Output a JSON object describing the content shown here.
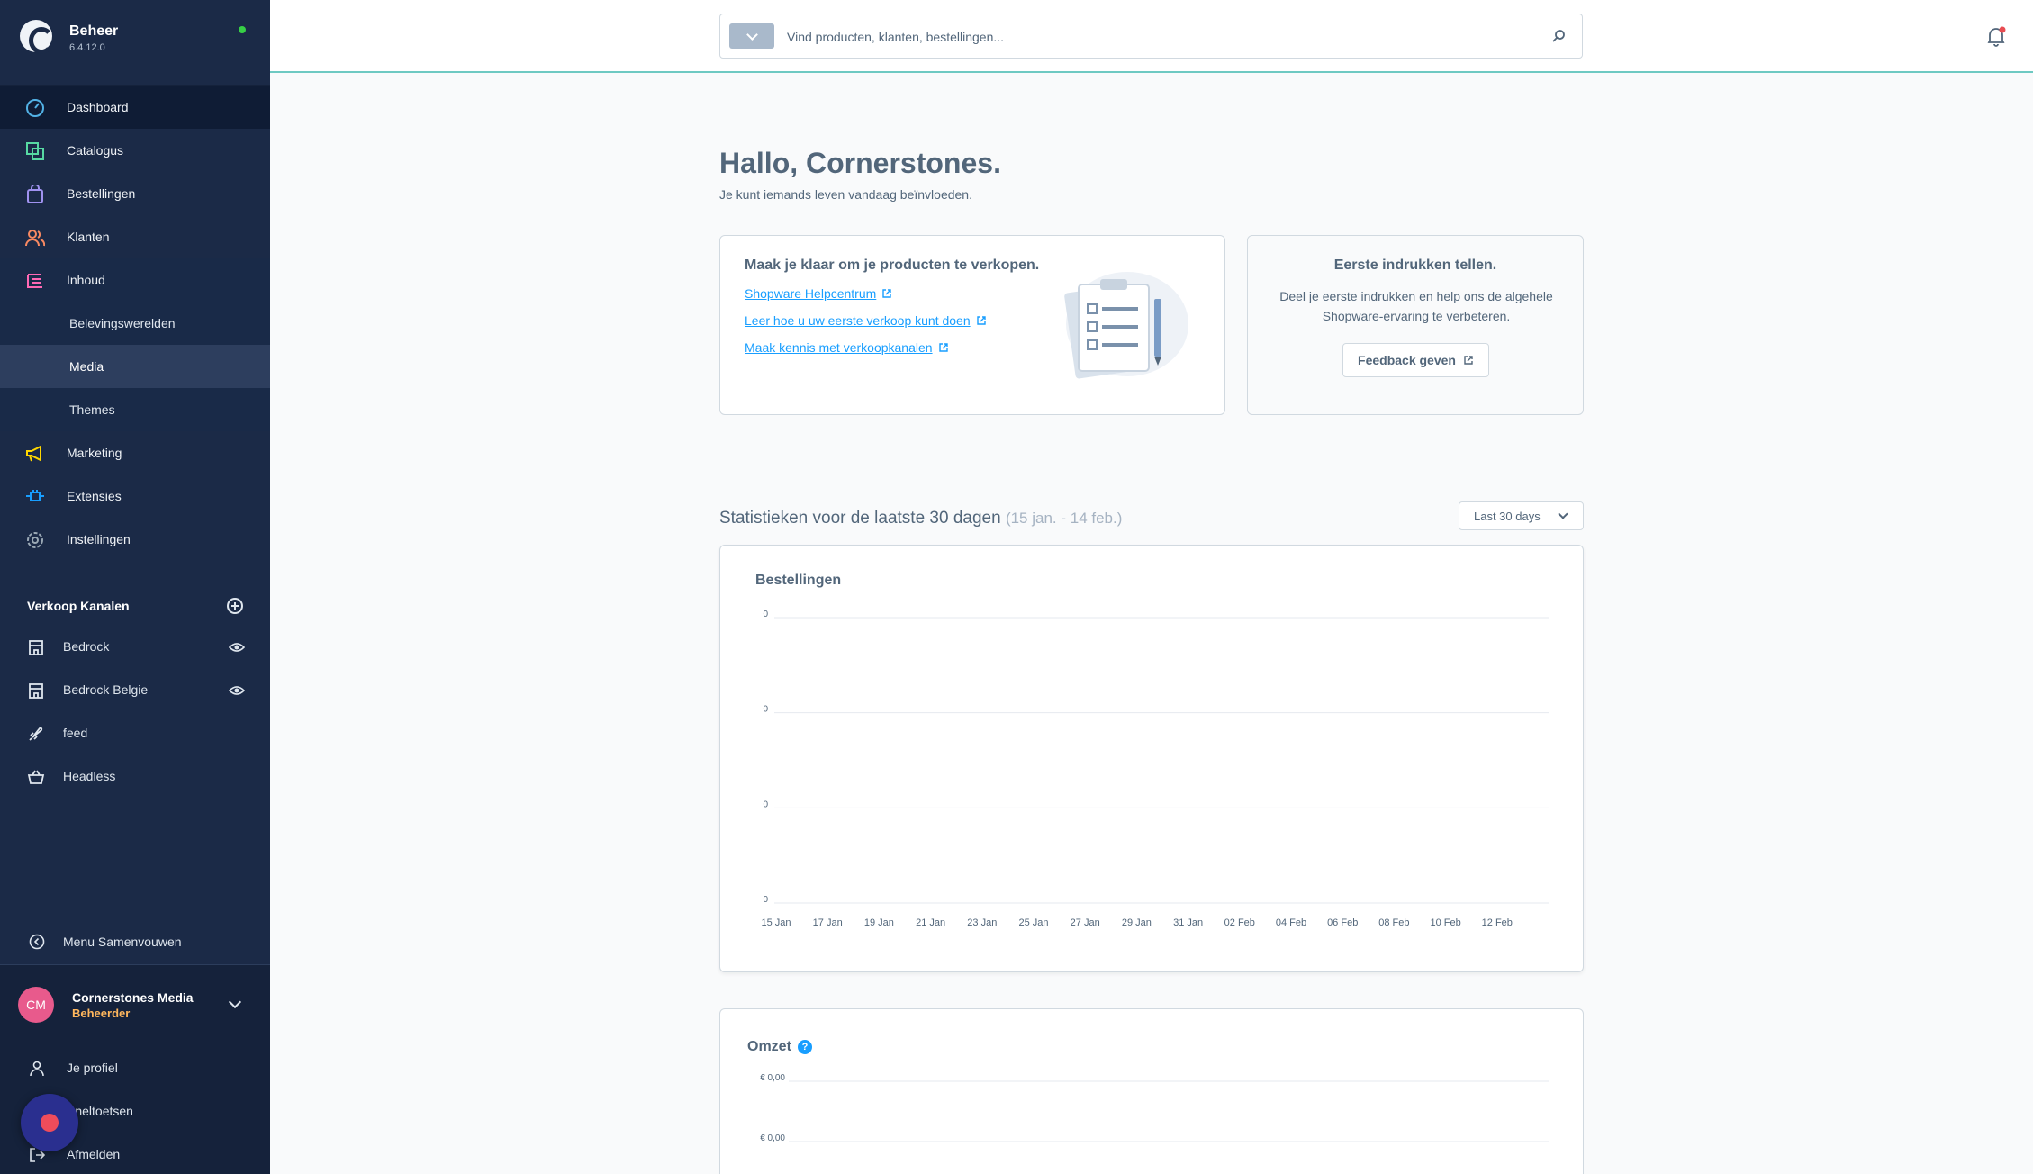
{
  "app": {
    "name": "Beheer",
    "version": "6.4.12.0"
  },
  "sidebar": {
    "nav": [
      {
        "label": "Dashboard",
        "icon": "dashboard-icon"
      },
      {
        "label": "Catalogus",
        "icon": "catalog-icon"
      },
      {
        "label": "Bestellingen",
        "icon": "orders-bag-icon"
      },
      {
        "label": "Klanten",
        "icon": "customers-icon"
      },
      {
        "label": "Inhoud",
        "icon": "content-icon"
      }
    ],
    "content_sub": [
      {
        "label": "Belevingswerelden"
      },
      {
        "label": "Media"
      },
      {
        "label": "Themes"
      }
    ],
    "nav2": [
      {
        "label": "Marketing",
        "icon": "megaphone-icon"
      },
      {
        "label": "Extensies",
        "icon": "plug-icon"
      },
      {
        "label": "Instellingen",
        "icon": "gear-icon"
      }
    ],
    "sales_channels_title": "Verkoop Kanalen",
    "sales_channels": [
      {
        "label": "Bedrock",
        "icon": "storefront-icon"
      },
      {
        "label": "Bedrock Belgie",
        "icon": "storefront-icon"
      },
      {
        "label": "feed",
        "icon": "rocket-icon"
      },
      {
        "label": "Headless",
        "icon": "basket-icon"
      }
    ],
    "collapse_label": "Menu Samenvouwen",
    "user": {
      "initials": "CM",
      "name": "Cornerstones Media",
      "role": "Beheerder"
    },
    "bottom_links": [
      {
        "label": "Je profiel"
      },
      {
        "label": "Sneltoetsen"
      },
      {
        "label": "Afmelden"
      }
    ]
  },
  "search": {
    "placeholder": "Vind producten, klanten, bestellingen..."
  },
  "main": {
    "greeting": "Hallo, Cornerstones.",
    "subgreeting": "Je kunt iemands leven vandaag beïnvloeden.",
    "getting_started": {
      "title": "Maak je klaar om je producten te verkopen.",
      "links": [
        "Shopware Helpcentrum",
        "Leer hoe u uw eerste verkoop kunt doen",
        "Maak kennis met verkoopkanalen"
      ]
    },
    "feedback": {
      "title": "Eerste indrukken tellen.",
      "text": "Deel je eerste indrukken en help ons de algehele Shopware-ervaring te verbeteren.",
      "button": "Feedback geven"
    },
    "stats_title": "Statistieken voor de laatste 30 dagen",
    "stats_range": "(15 jan. - 14 feb.)",
    "range_select": "Last 30 days",
    "omzet_title": "Omzet"
  },
  "colors": {
    "accent": "#189eff",
    "sidebar": "#1b2a47",
    "status_online": "#37d046",
    "role": "#ffb75d"
  },
  "chart_data": [
    {
      "type": "line",
      "title": "Bestellingen",
      "x": [
        "15 Jan",
        "17 Jan",
        "19 Jan",
        "21 Jan",
        "23 Jan",
        "25 Jan",
        "27 Jan",
        "29 Jan",
        "31 Jan",
        "02 Feb",
        "04 Feb",
        "06 Feb",
        "08 Feb",
        "10 Feb",
        "12 Feb"
      ],
      "y_tick_labels": [
        "0",
        "0",
        "0",
        "0"
      ],
      "series": [
        {
          "values": [
            0,
            0,
            0,
            0,
            0,
            0,
            0,
            0,
            0,
            0,
            0,
            0,
            0,
            0,
            0
          ]
        }
      ],
      "grid": true
    },
    {
      "type": "line",
      "title": "Omzet",
      "y_tick_labels": [
        "€ 0,00",
        "€ 0,00"
      ],
      "grid": true
    }
  ]
}
